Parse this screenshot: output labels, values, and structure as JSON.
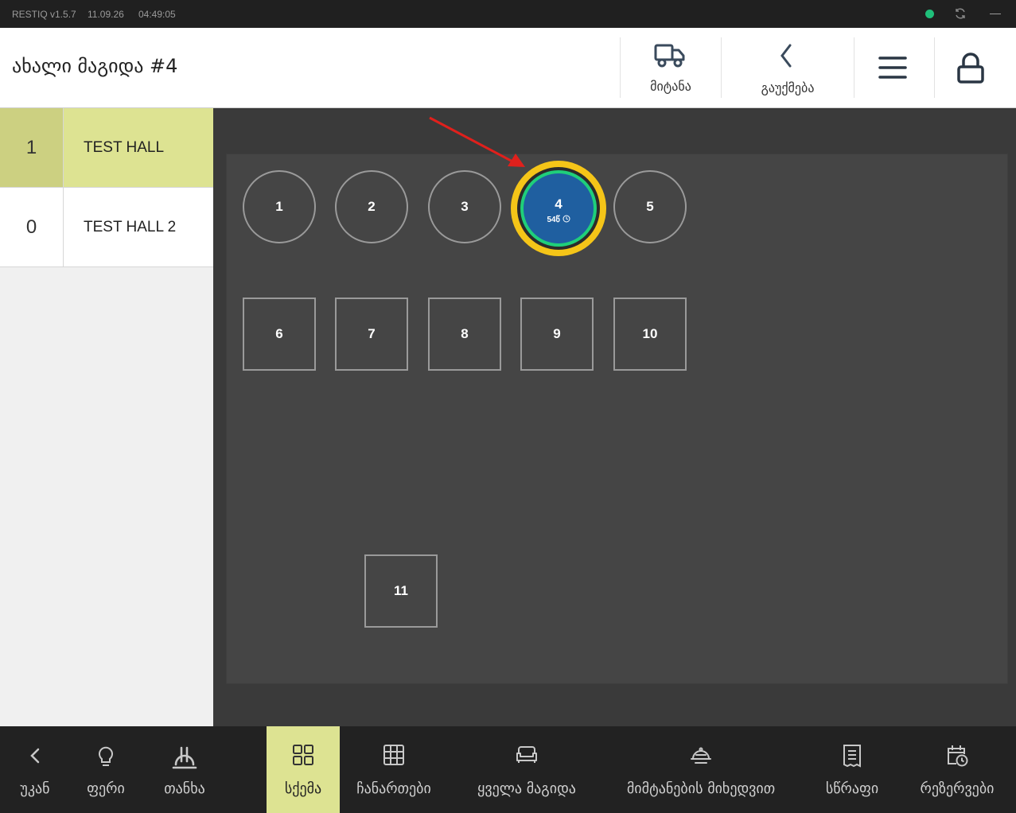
{
  "titlebar": {
    "app_version": "RESTIQ v1.5.7",
    "date": "11.09.26",
    "time": "04:49:05",
    "status_color": "#1fbf7a"
  },
  "header": {
    "title": "ახალი მაგიდა #4",
    "buttons": {
      "delivery": {
        "label": "მიტანა",
        "icon": "truck-icon"
      },
      "cancel": {
        "label": "გაუქმება",
        "icon": "chevron-left-icon"
      },
      "menu": {
        "icon": "hamburger-menu-icon"
      },
      "lock": {
        "icon": "lock-icon"
      }
    }
  },
  "halls": [
    {
      "count": "1",
      "name": "TEST HALL",
      "active": true
    },
    {
      "count": "0",
      "name": "TEST HALL 2",
      "active": false
    }
  ],
  "tables": [
    {
      "number": "1",
      "shape": "round"
    },
    {
      "number": "2",
      "shape": "round"
    },
    {
      "number": "3",
      "shape": "round"
    },
    {
      "number": "4",
      "shape": "round",
      "selected": true,
      "timer": "54წ"
    },
    {
      "number": "5",
      "shape": "round"
    },
    {
      "number": "6",
      "shape": "square"
    },
    {
      "number": "7",
      "shape": "square"
    },
    {
      "number": "8",
      "shape": "square"
    },
    {
      "number": "9",
      "shape": "square"
    },
    {
      "number": "10",
      "shape": "square"
    },
    {
      "number": "11",
      "shape": "square"
    }
  ],
  "bottom_nav": [
    {
      "label": "უკან",
      "icon": "chevron-left-icon"
    },
    {
      "label": "ფერი",
      "icon": "lightbulb-icon"
    },
    {
      "label": "თანხა",
      "icon": "lari-icon"
    },
    {
      "label": "სქემა",
      "icon": "grid-icon",
      "active": true
    },
    {
      "label": "ჩანართები",
      "icon": "table-icon"
    },
    {
      "label": "ყველა მაგიდა",
      "icon": "sofa-icon"
    },
    {
      "label": "მიმტანების მიხედვით",
      "icon": "serving-dish-icon"
    },
    {
      "label": "სწრაფი",
      "icon": "receipt-icon"
    },
    {
      "label": "რეზერვები",
      "icon": "calendar-clock-icon"
    }
  ],
  "colors": {
    "accent": "#dde392",
    "selected_table_fill": "#1f5fa0",
    "selected_table_ring": "#1fcf7a",
    "selected_table_border": "#f5c518"
  }
}
